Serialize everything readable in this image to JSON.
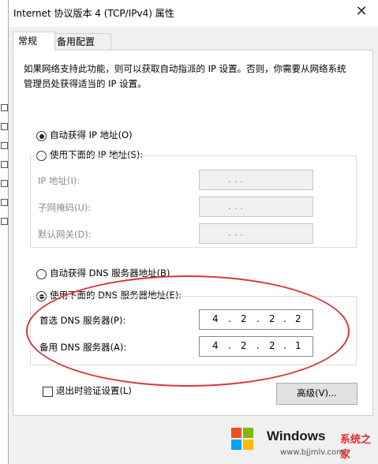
{
  "window": {
    "title": "Internet 协议版本 4 (TCP/IPv4) 属性",
    "close_glyph": "✕"
  },
  "tabs": [
    {
      "label": "常规"
    },
    {
      "label": "备用配置"
    }
  ],
  "description": "如果网络支持此功能，则可以获取自动指派的 IP 设置。否则，你需要从网络系统管理员处获得适当的 IP 设置。",
  "ip_mode": {
    "auto_label": "自动获得 IP 地址(O)",
    "manual_label": "使用下面的 IP 地址(S):",
    "selected": "auto"
  },
  "ip_fields": [
    {
      "label": "IP 地址(I):",
      "value": ".     .     ."
    },
    {
      "label": "子网掩码(U):",
      "value": ".     .     ."
    },
    {
      "label": "默认网关(D):",
      "value": ".     .     ."
    }
  ],
  "dns_mode": {
    "auto_label": "自动获得 DNS 服务器地址(B)",
    "manual_label": "使用下面的 DNS 服务器地址(E):",
    "selected": "manual"
  },
  "dns_fields": [
    {
      "label": "首选 DNS 服务器(P):",
      "octets": [
        "4",
        "2",
        "2",
        "2"
      ]
    },
    {
      "label": "备用 DNS 服务器(A):",
      "octets": [
        "4",
        "2",
        "2",
        "1"
      ]
    }
  ],
  "validate": {
    "label": "退出时验证设置(L)",
    "checked": false
  },
  "advanced_button": "高级(V)...",
  "watermark": {
    "brand": "Windows",
    "suffix": "系统之家",
    "url": "www.bjjmlv.com"
  },
  "colors": {
    "highlight_ellipse": "#d9373a",
    "watermark_red": "#e8272b"
  }
}
